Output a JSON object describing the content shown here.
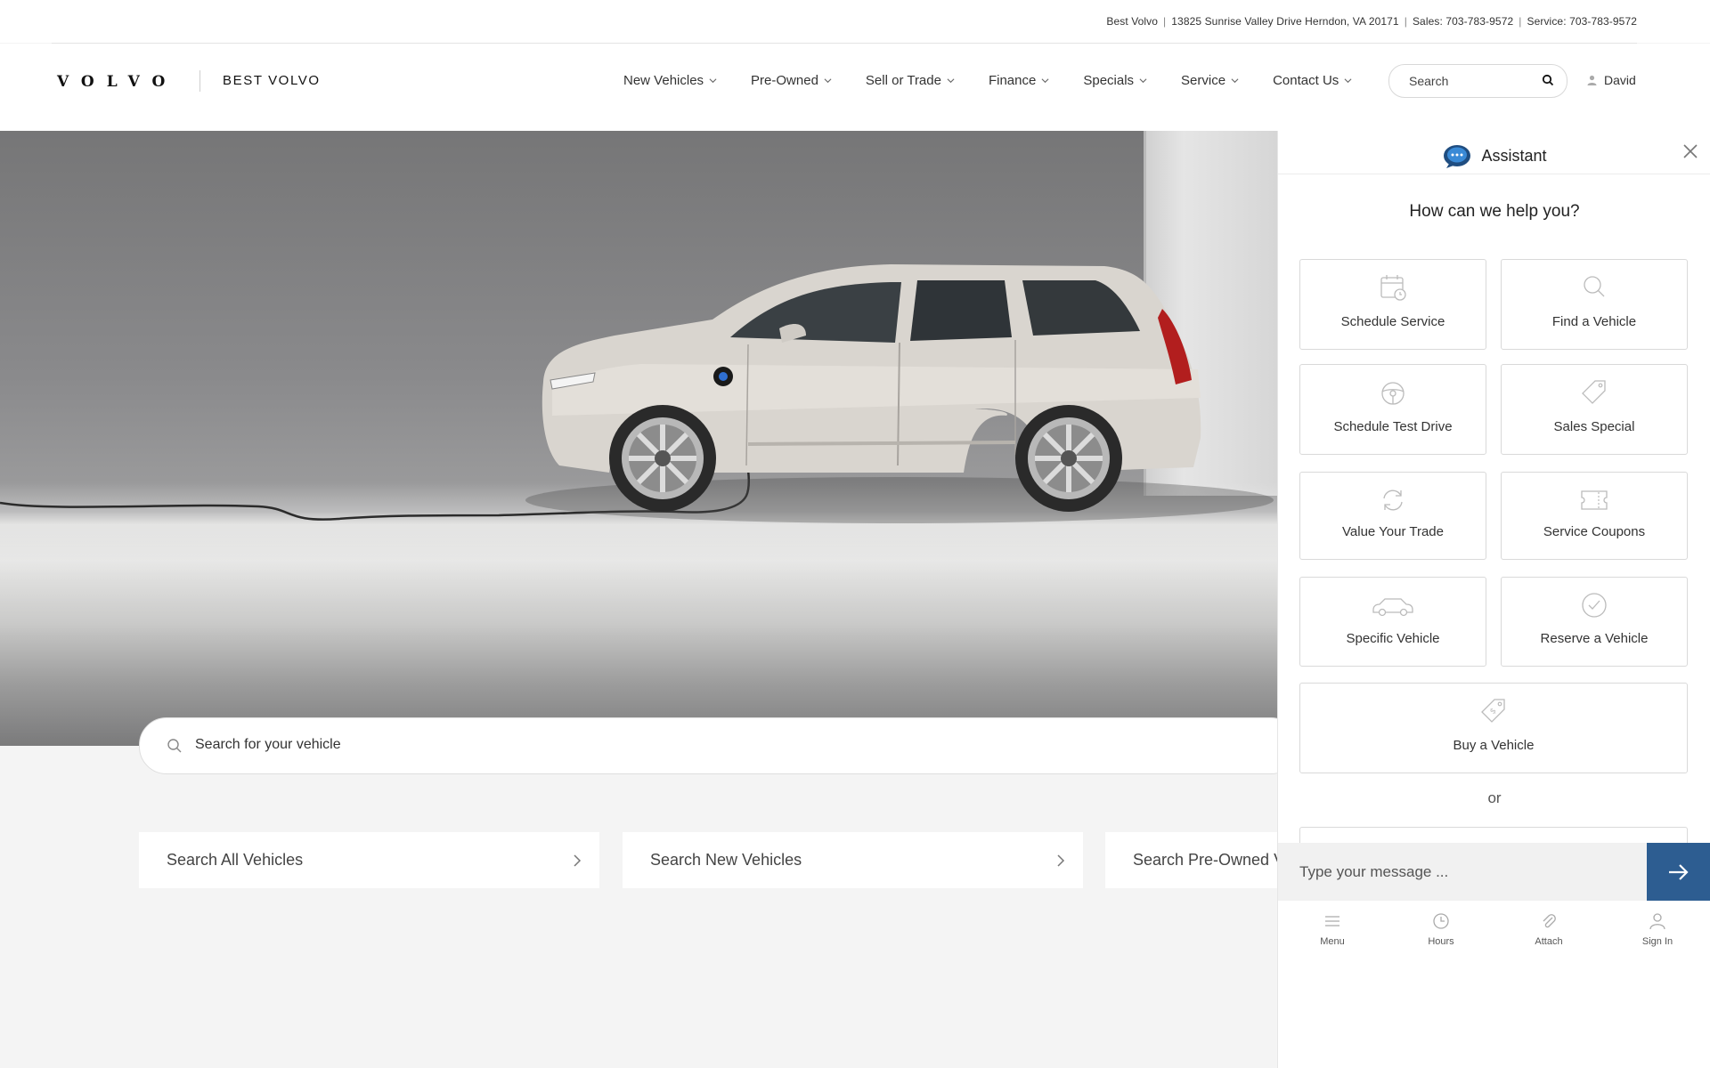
{
  "dealer_info": {
    "name": "Best Volvo",
    "address": "13825 Sunrise Valley Drive Herndon, VA 20171",
    "sales": "Sales: 703-783-9572",
    "service": "Service: 703-783-9572"
  },
  "header": {
    "logo_text": "VOLVO",
    "dealer_name": "BEST VOLVO",
    "nav": [
      {
        "label": "New Vehicles"
      },
      {
        "label": "Pre-Owned"
      },
      {
        "label": "Sell or Trade"
      },
      {
        "label": "Finance"
      },
      {
        "label": "Specials"
      },
      {
        "label": "Service"
      },
      {
        "label": "Contact Us"
      }
    ],
    "search_placeholder": "Search",
    "user_name": "David"
  },
  "hero": {
    "search_placeholder": "Search for your vehicle"
  },
  "search_cards": [
    {
      "label": "Search All Vehicles"
    },
    {
      "label": "Search New Vehicles"
    },
    {
      "label": "Search Pre-Owned Ve"
    }
  ],
  "assistant": {
    "title": "Assistant",
    "question": "How can we help you?",
    "tiles": [
      {
        "label": "Schedule Service",
        "icon": "calendar-clock-icon"
      },
      {
        "label": "Find a Vehicle",
        "icon": "magnifier-icon"
      },
      {
        "label": "Schedule Test Drive",
        "icon": "steering-wheel-icon"
      },
      {
        "label": "Sales Special",
        "icon": "price-tag-icon"
      },
      {
        "label": "Value Your Trade",
        "icon": "refresh-icon"
      },
      {
        "label": "Service Coupons",
        "icon": "ticket-icon"
      },
      {
        "label": "Specific Vehicle",
        "icon": "car-icon"
      },
      {
        "label": "Reserve a Vehicle",
        "icon": "check-circle-icon"
      },
      {
        "label": "Buy a Vehicle",
        "icon": "dollar-tag-icon"
      }
    ],
    "or_text": "or",
    "message_placeholder": "Type your message ...",
    "footer": [
      {
        "label": "Menu",
        "icon": "menu-icon"
      },
      {
        "label": "Hours",
        "icon": "clock-icon"
      },
      {
        "label": "Attach",
        "icon": "paperclip-icon"
      },
      {
        "label": "Sign In",
        "icon": "person-icon"
      }
    ],
    "accent_color": "#2d5d91"
  }
}
